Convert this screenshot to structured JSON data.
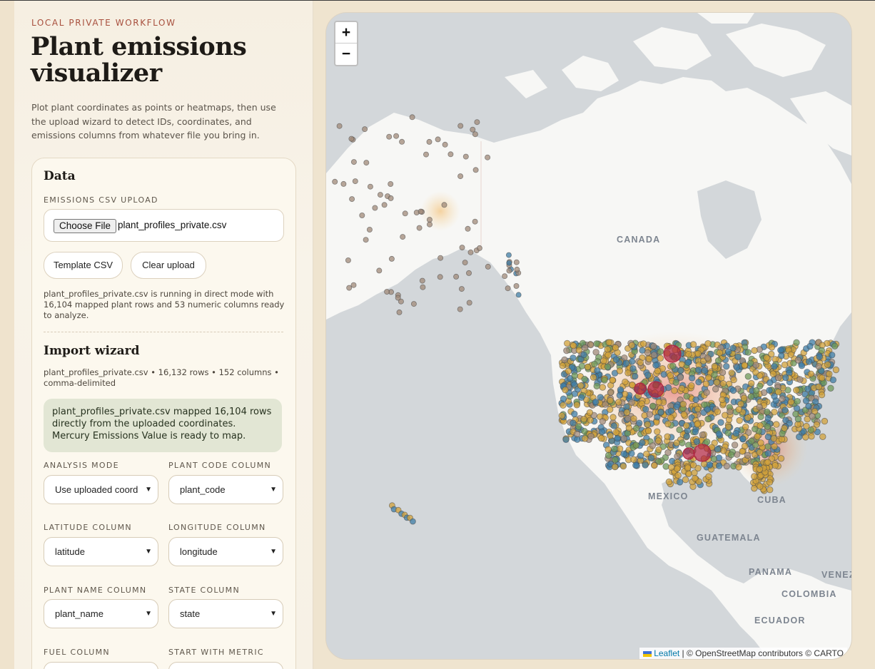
{
  "sidebar": {
    "eyebrow": "LOCAL PRIVATE WORKFLOW",
    "title": "Plant emissions visualizer",
    "lede": "Plot plant coordinates as points or heatmaps, then use the upload wizard to detect IDs, coordinates, and emissions columns from whatever file you bring in."
  },
  "data_card": {
    "heading": "Data",
    "upload_label": "EMISSIONS CSV UPLOAD",
    "choose_file": "Choose File",
    "file_name": "plant_profiles_private.csv",
    "template_button": "Template CSV",
    "clear_button": "Clear upload",
    "status": "plant_profiles_private.csv is running in direct mode with 16,104 mapped plant rows and 53 numeric columns ready to analyze."
  },
  "wizard": {
    "heading": "Import wizard",
    "meta": "plant_profiles_private.csv • 16,132 rows • 152 columns • comma-delimited",
    "notice": "plant_profiles_private.csv mapped 16,104 rows directly from the uploaded coordinates. Mercury Emissions Value is ready to map.",
    "fields": [
      {
        "label": "ANALYSIS MODE",
        "value": "Use uploaded coord"
      },
      {
        "label": "PLANT CODE COLUMN",
        "value": "plant_code"
      },
      {
        "label": "LATITUDE COLUMN",
        "value": "latitude"
      },
      {
        "label": "LONGITUDE COLUMN",
        "value": "longitude"
      },
      {
        "label": "PLANT NAME COLUMN",
        "value": "plant_name"
      },
      {
        "label": "STATE COLUMN",
        "value": "state"
      },
      {
        "label": "FUEL COLUMN",
        "value": ""
      },
      {
        "label": "START WITH METRIC",
        "value": ""
      }
    ]
  },
  "map": {
    "zoom_in": "+",
    "zoom_out": "−",
    "labels": {
      "canada": "CANADA",
      "mexico": "MEXICO",
      "cuba": "CUBA",
      "guatemala": "GUATEMALA",
      "panama": "PANAMA",
      "venezuela": "VENEZU",
      "colombia": "COLOMBIA",
      "ecuador": "ECUADOR"
    },
    "attribution": {
      "leaflet": "Leaflet",
      "rest": " | © OpenStreetMap contributors © CARTO"
    },
    "colors": {
      "water": "#d3d7da",
      "land": "#f7f7f5",
      "point_gold": "#d2a23a",
      "point_blue": "#3f7ea6",
      "point_green": "#6f9a5a",
      "point_brown": "#a08a78",
      "hotspot": "#b0213f"
    }
  }
}
